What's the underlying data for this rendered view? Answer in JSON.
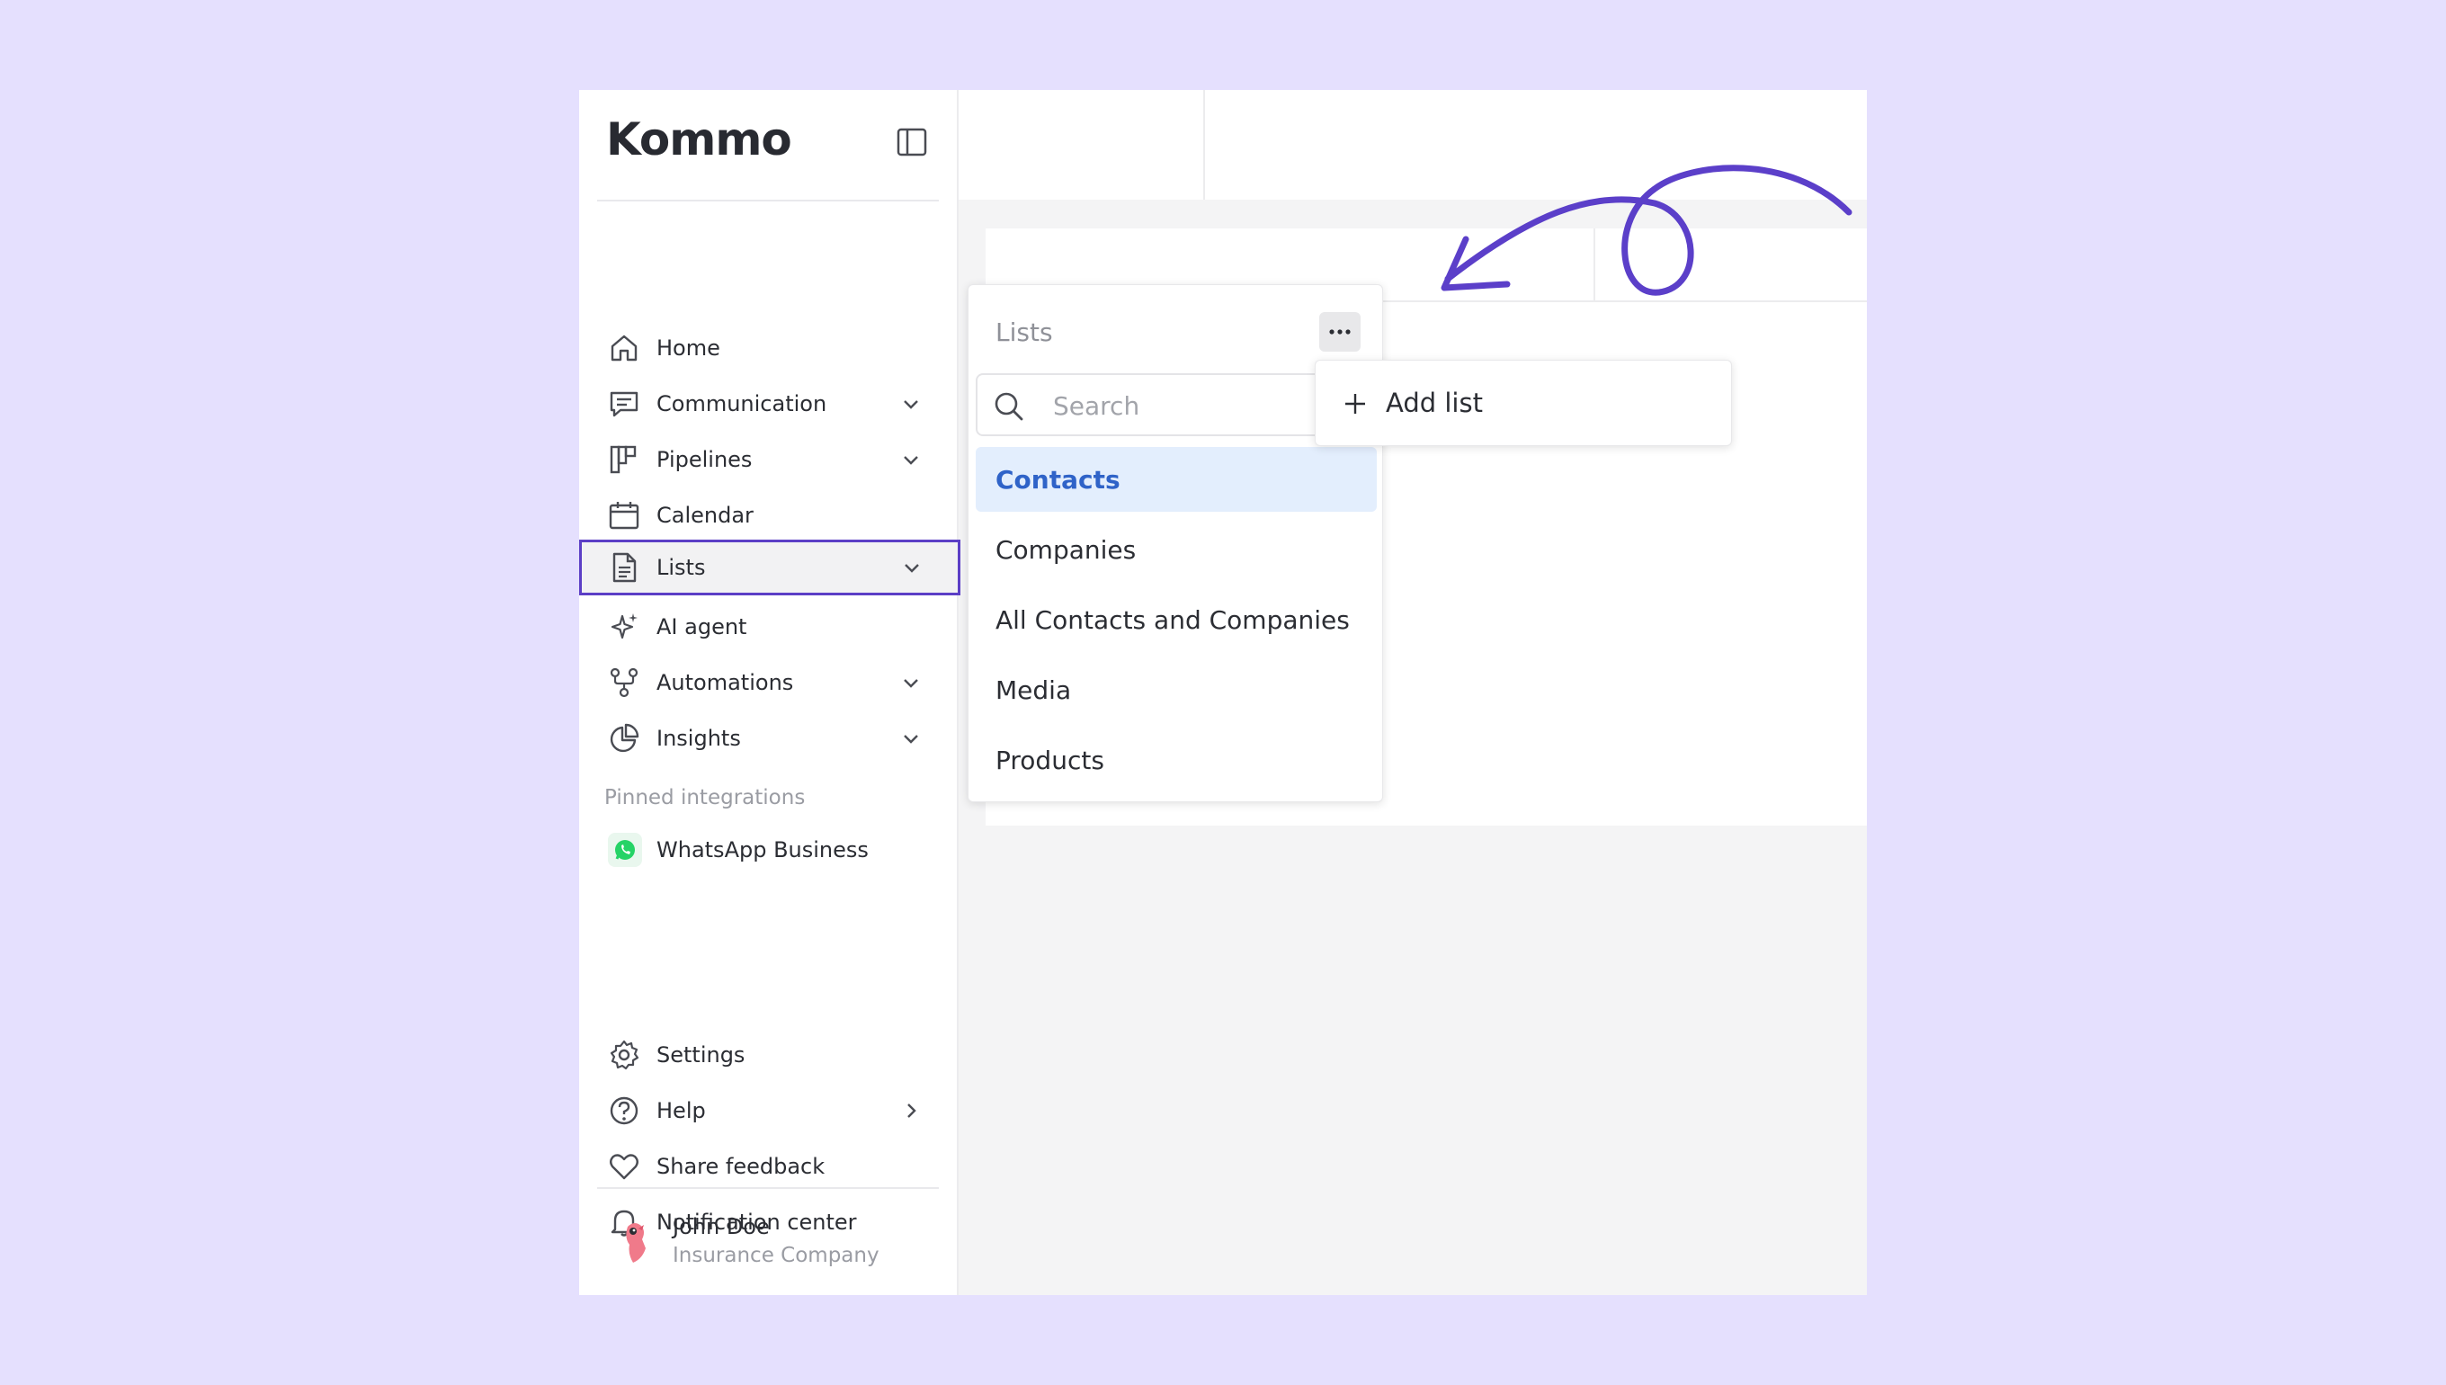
{
  "app": {
    "logo_text": "Kommo"
  },
  "sidebar": {
    "items": [
      {
        "id": "home",
        "label": "Home",
        "icon": "home-icon",
        "has_chevron": false
      },
      {
        "id": "communication",
        "label": "Communication",
        "icon": "chat-icon",
        "has_chevron": true
      },
      {
        "id": "pipelines",
        "label": "Pipelines",
        "icon": "pipelines-icon",
        "has_chevron": true
      },
      {
        "id": "calendar",
        "label": "Calendar",
        "icon": "calendar-icon",
        "has_chevron": false
      },
      {
        "id": "lists",
        "label": "Lists",
        "icon": "document-icon",
        "has_chevron": true,
        "active": true
      },
      {
        "id": "ai-agent",
        "label": "AI agent",
        "icon": "sparkle-icon",
        "has_chevron": false
      },
      {
        "id": "automations",
        "label": "Automations",
        "icon": "automations-icon",
        "has_chevron": true
      },
      {
        "id": "insights",
        "label": "Insights",
        "icon": "pie-chart-icon",
        "has_chevron": true
      }
    ],
    "pinned_title": "Pinned integrations",
    "pinned": [
      {
        "label": "WhatsApp Business",
        "icon": "whatsapp-icon"
      }
    ],
    "bottom_items": [
      {
        "id": "settings",
        "label": "Settings",
        "icon": "gear-icon",
        "has_chevron": false
      },
      {
        "id": "help",
        "label": "Help",
        "icon": "help-icon",
        "has_chevron": true
      },
      {
        "id": "share-feedback",
        "label": "Share feedback",
        "icon": "heart-icon",
        "has_chevron": false
      },
      {
        "id": "notification-center",
        "label": "Notification center",
        "icon": "bell-icon",
        "has_chevron": false
      }
    ],
    "user": {
      "name": "John Doe",
      "company": "Insurance Company"
    }
  },
  "lists_panel": {
    "title": "Lists",
    "search_placeholder": "Search",
    "items": [
      "Contacts",
      "Companies",
      "All Contacts and Companies",
      "Media",
      "Products"
    ],
    "selected_index": 0
  },
  "more_menu": {
    "add_label": "Add list"
  },
  "colors": {
    "background": "#e5e0fe",
    "active_border": "#5c3fc6",
    "selected_bg": "#e3eefd",
    "selected_text": "#2f63c8",
    "annotation": "#5b3fc9"
  }
}
